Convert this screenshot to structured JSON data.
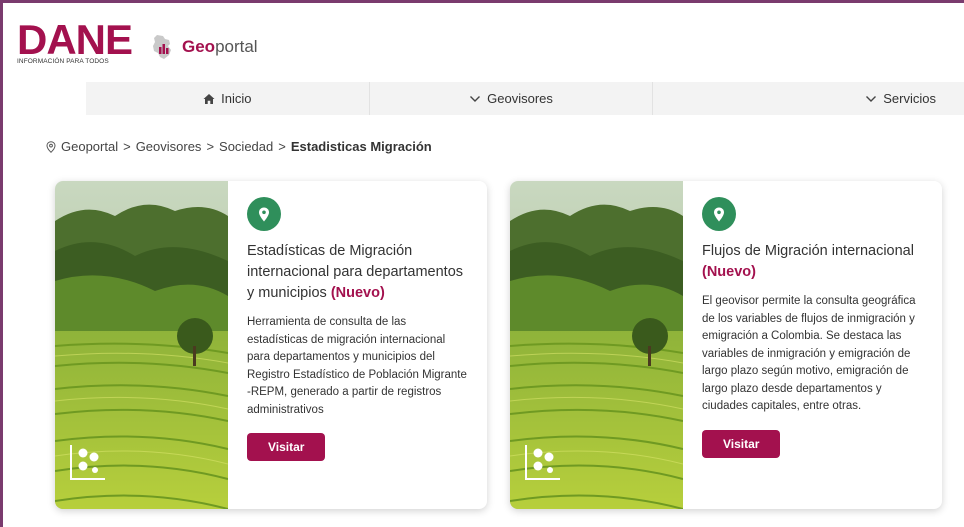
{
  "brand": {
    "dane_word": "DANE",
    "dane_tagline": "INFORMACIÓN PARA TODOS",
    "geoportal_strong": "Geo",
    "geoportal_rest": "portal"
  },
  "nav": {
    "items": [
      {
        "label": "Inicio",
        "icon": "home-icon"
      },
      {
        "label": "Geovisores",
        "icon": "chevron-down-icon"
      },
      {
        "label": "Servicios",
        "icon": "chevron-down-icon"
      }
    ]
  },
  "breadcrumb": {
    "items": [
      "Geoportal",
      "Geovisores",
      "Sociedad"
    ],
    "separator": ">",
    "current": "Estadisticas Migración"
  },
  "cards": [
    {
      "title": "Estadísticas de Migración internacional para departamentos y municipios",
      "badge": "(Nuevo)",
      "description": "Herramienta de consulta de las estadísticas de migración internacional para departamentos y municipios del Registro Estadístico de Población Migrante -REPM, generado a partir de registros administrativos",
      "button": "Visitar"
    },
    {
      "title": "Flujos de Migración internacional",
      "badge": "(Nuevo)",
      "description": "El geovisor permite la consulta geográfica de los variables de flujos de inmigración y emigración a Colombia. Se destaca las variables de inmigración y emigración de largo plazo según motivo, emigración de largo plazo desde departamentos y ciudades capitales, entre otras.",
      "button": "Visitar"
    }
  ],
  "colors": {
    "brand": "#a3114e",
    "pin_badge": "#2f8f5b",
    "frame": "#7a3b6e",
    "nav_bg": "#f3f3f3"
  }
}
